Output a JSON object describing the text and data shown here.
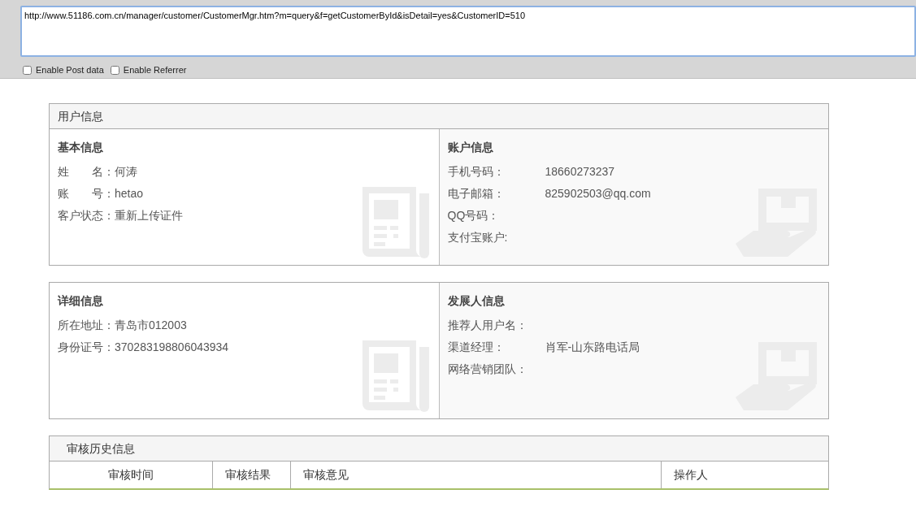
{
  "request_bar": {
    "url": "http://www.51186.com.cn/manager/customer/CustomerMgr.htm?m=query&f=getCustomerById&isDetail=yes&CustomerID=510",
    "options": [
      {
        "label": "Enable Post data",
        "checked": false
      },
      {
        "label": "Enable Referrer",
        "checked": false
      }
    ]
  },
  "user_panel": {
    "title": "用户信息",
    "sections": [
      {
        "title": "基本信息",
        "kind": "document",
        "fields": [
          {
            "label": "姓　　名：",
            "value": "何涛"
          },
          {
            "label": "账　　号：",
            "value": "hetao"
          },
          {
            "label": "客户状态：",
            "value": "重新上传证件"
          }
        ]
      },
      {
        "title": "账户信息",
        "kind": "hand",
        "fields": [
          {
            "label": "手机号码：",
            "value": "18660273237"
          },
          {
            "label": "电子邮箱：",
            "value": "825902503@qq.com"
          },
          {
            "label": "QQ号码："
          },
          {
            "label": "支付宝账户:"
          }
        ]
      }
    ]
  },
  "detail_panel": {
    "sections": [
      {
        "title": "详细信息",
        "kind": "document",
        "fields": [
          {
            "label": "所在地址：",
            "value": "青岛市012003"
          },
          {
            "label": "身份证号：",
            "value": "370283198806043934"
          }
        ]
      },
      {
        "title": "发展人信息",
        "kind": "hand",
        "fields": [
          {
            "label": "推荐人用户名："
          },
          {
            "label": "渠道经理：",
            "value": "肖军-山东路电话局"
          },
          {
            "label": "网络营销团队："
          }
        ]
      }
    ]
  },
  "history_panel": {
    "title": "审核历史信息",
    "columns": [
      "审核时间",
      "审核结果",
      "审核意见",
      "操作人"
    ]
  }
}
